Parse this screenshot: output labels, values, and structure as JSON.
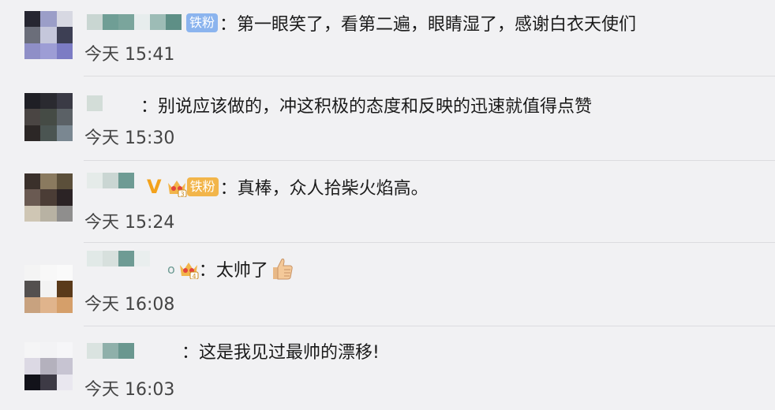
{
  "comments": [
    {
      "badge": "铁粉",
      "separator": "：",
      "text": "第一眼笑了，看第二遍，眼睛湿了，感谢白衣天使们",
      "time": "今天 15:41"
    },
    {
      "separator": "：",
      "text": "别说应该做的，冲这积极的态度和反映的迅速就值得点赞",
      "time": "今天 15:30"
    },
    {
      "vip": "V",
      "badge": "铁粉",
      "crown_level": "3",
      "separator": "：",
      "text": "真棒，众人拾柴火焰高。",
      "time": "今天 15:24"
    },
    {
      "name_tail": "o",
      "crown_level": "4",
      "separator": "：",
      "text": "太帅了",
      "emoji": "thumbs-up-icon",
      "time": "今天 16:08"
    },
    {
      "separator": "：",
      "text": "这是我见过最帅的漂移!",
      "time": "今天 16:03"
    }
  ],
  "colors": {
    "background": "#f1f1f3",
    "fan_badge_blue": "#8bb4ee",
    "fan_badge_orange": "#f2b54a",
    "vip": "#f3a21c",
    "divider": "#dcdcdf"
  }
}
